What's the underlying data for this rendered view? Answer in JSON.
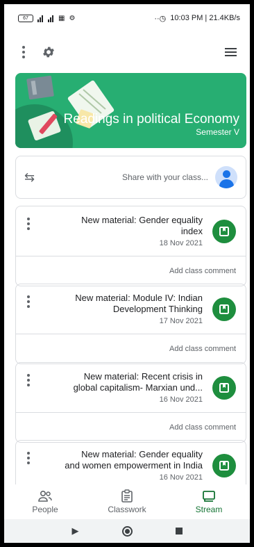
{
  "status_bar": {
    "time_and_speed": "10:03 PM | 21.4KB/s",
    "battery": "67"
  },
  "banner": {
    "title": "Readings in political Economy",
    "subtitle": "Semester V",
    "color": "#27ae72"
  },
  "share": {
    "placeholder": "Share with your class..."
  },
  "posts": [
    {
      "title": "New material: Gender equality index",
      "date": "18 Nov 2021",
      "comment": "Add class comment"
    },
    {
      "title": "New material: Module IV: Indian Development Thinking",
      "date": "17 Nov 2021",
      "comment": "Add class comment"
    },
    {
      "title": "New material: Recent crisis in global capitalism- Marxian und...",
      "date": "16 Nov 2021",
      "comment": "Add class comment"
    },
    {
      "title": "New material: Gender equality and women empowerment in India",
      "date": "16 Nov 2021",
      "comment": ""
    }
  ],
  "bottom_nav": {
    "stream": "Stream",
    "classwork": "Classwork",
    "people": "People",
    "active_color": "#137333"
  },
  "icons": [
    "menu-icon",
    "gear-icon",
    "more-vert-icon",
    "repost-icon",
    "avatar-icon",
    "material-icon",
    "stream-icon",
    "classwork-icon",
    "people-icon",
    "back-icon",
    "home-icon",
    "recents-icon"
  ]
}
